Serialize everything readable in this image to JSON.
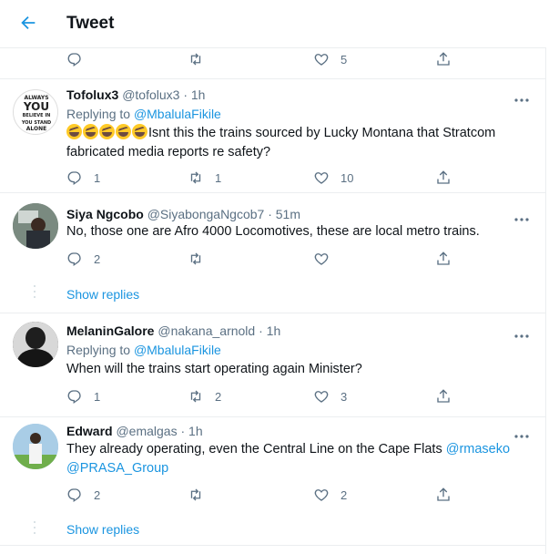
{
  "header": {
    "title": "Tweet"
  },
  "top_actions": {
    "reply": "",
    "retweet": "",
    "like": "5"
  },
  "tweets": [
    {
      "name": "Tofolux3",
      "handle": "@tofolux3",
      "time": "· 1h",
      "replying_prefix": "Replying to ",
      "replying_to": "@MbalulaFikile",
      "text": "Isnt this the trains sourced by Lucky Montana that Stratcom fabricated media reports re safety?",
      "reply_count": "1",
      "retweet_count": "1",
      "like_count": "10"
    },
    {
      "name": "Siya Ngcobo",
      "handle": "@SiyabongaNgcob7",
      "time": "· 51m",
      "text": "No, those one are Afro 4000 Locomotives, these are local metro trains.",
      "reply_count": "2",
      "retweet_count": "",
      "like_count": ""
    },
    {
      "name": "MelaninGalore",
      "handle": "@nakana_arnold",
      "time": "· 1h",
      "replying_prefix": "Replying to ",
      "replying_to": "@MbalulaFikile",
      "text": "When will the trains start operating again Minister?",
      "reply_count": "1",
      "retweet_count": "2",
      "like_count": "3"
    },
    {
      "name": "Edward",
      "handle": "@emalgas",
      "time": "· 1h",
      "text_prefix": "They already operating, even the Central Line on the Cape Flats ",
      "mention1": "@rmaseko",
      "mention2": "@PRASA_Group",
      "reply_count": "2",
      "retweet_count": "",
      "like_count": "2"
    }
  ],
  "avatar_text": [
    "ALWAYS",
    "YOU",
    "BELIEVE IN",
    "YOU STAND",
    "ALONE"
  ],
  "show_replies": "Show replies",
  "colors": {
    "accent": "#1b95e0",
    "muted": "#5b7083",
    "border": "#ebeef0",
    "text": "#0f1419"
  }
}
